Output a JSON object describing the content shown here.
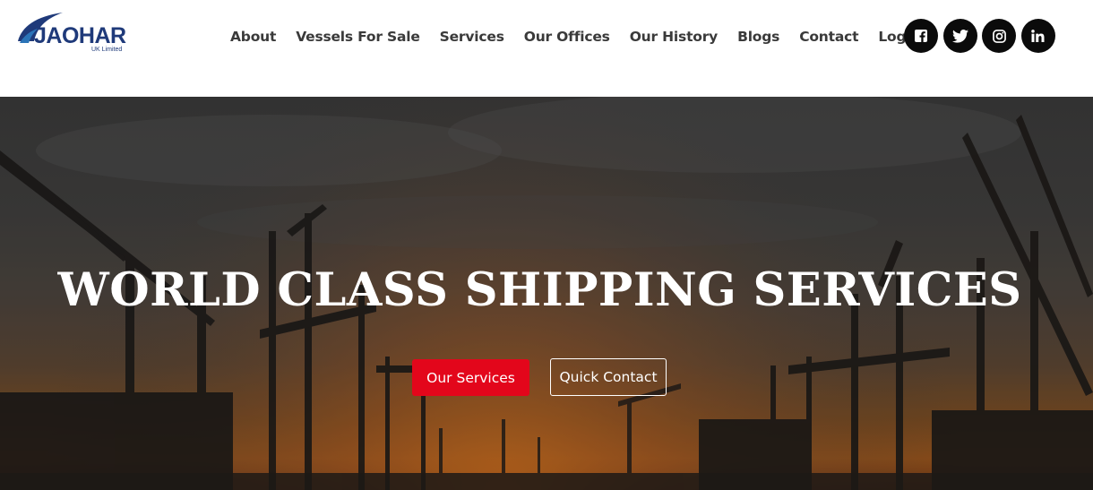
{
  "brand": {
    "name": "JAOHAR",
    "subtitle": "UK Limited",
    "color": "#1f3a7a"
  },
  "nav": {
    "items": [
      {
        "label": "About"
      },
      {
        "label": "Vessels For Sale"
      },
      {
        "label": "Services"
      },
      {
        "label": "Our Offices"
      },
      {
        "label": "Our History"
      },
      {
        "label": "Blogs"
      },
      {
        "label": "Contact"
      },
      {
        "label": "Login"
      }
    ]
  },
  "social": {
    "icons": [
      "facebook-icon",
      "twitter-icon",
      "instagram-icon",
      "linkedin-icon"
    ]
  },
  "hero": {
    "title": "WORLD CLASS SHIPPING SERVICES",
    "primary_button": "Our Services",
    "secondary_button": "Quick Contact",
    "accent_color": "#e3061b"
  }
}
